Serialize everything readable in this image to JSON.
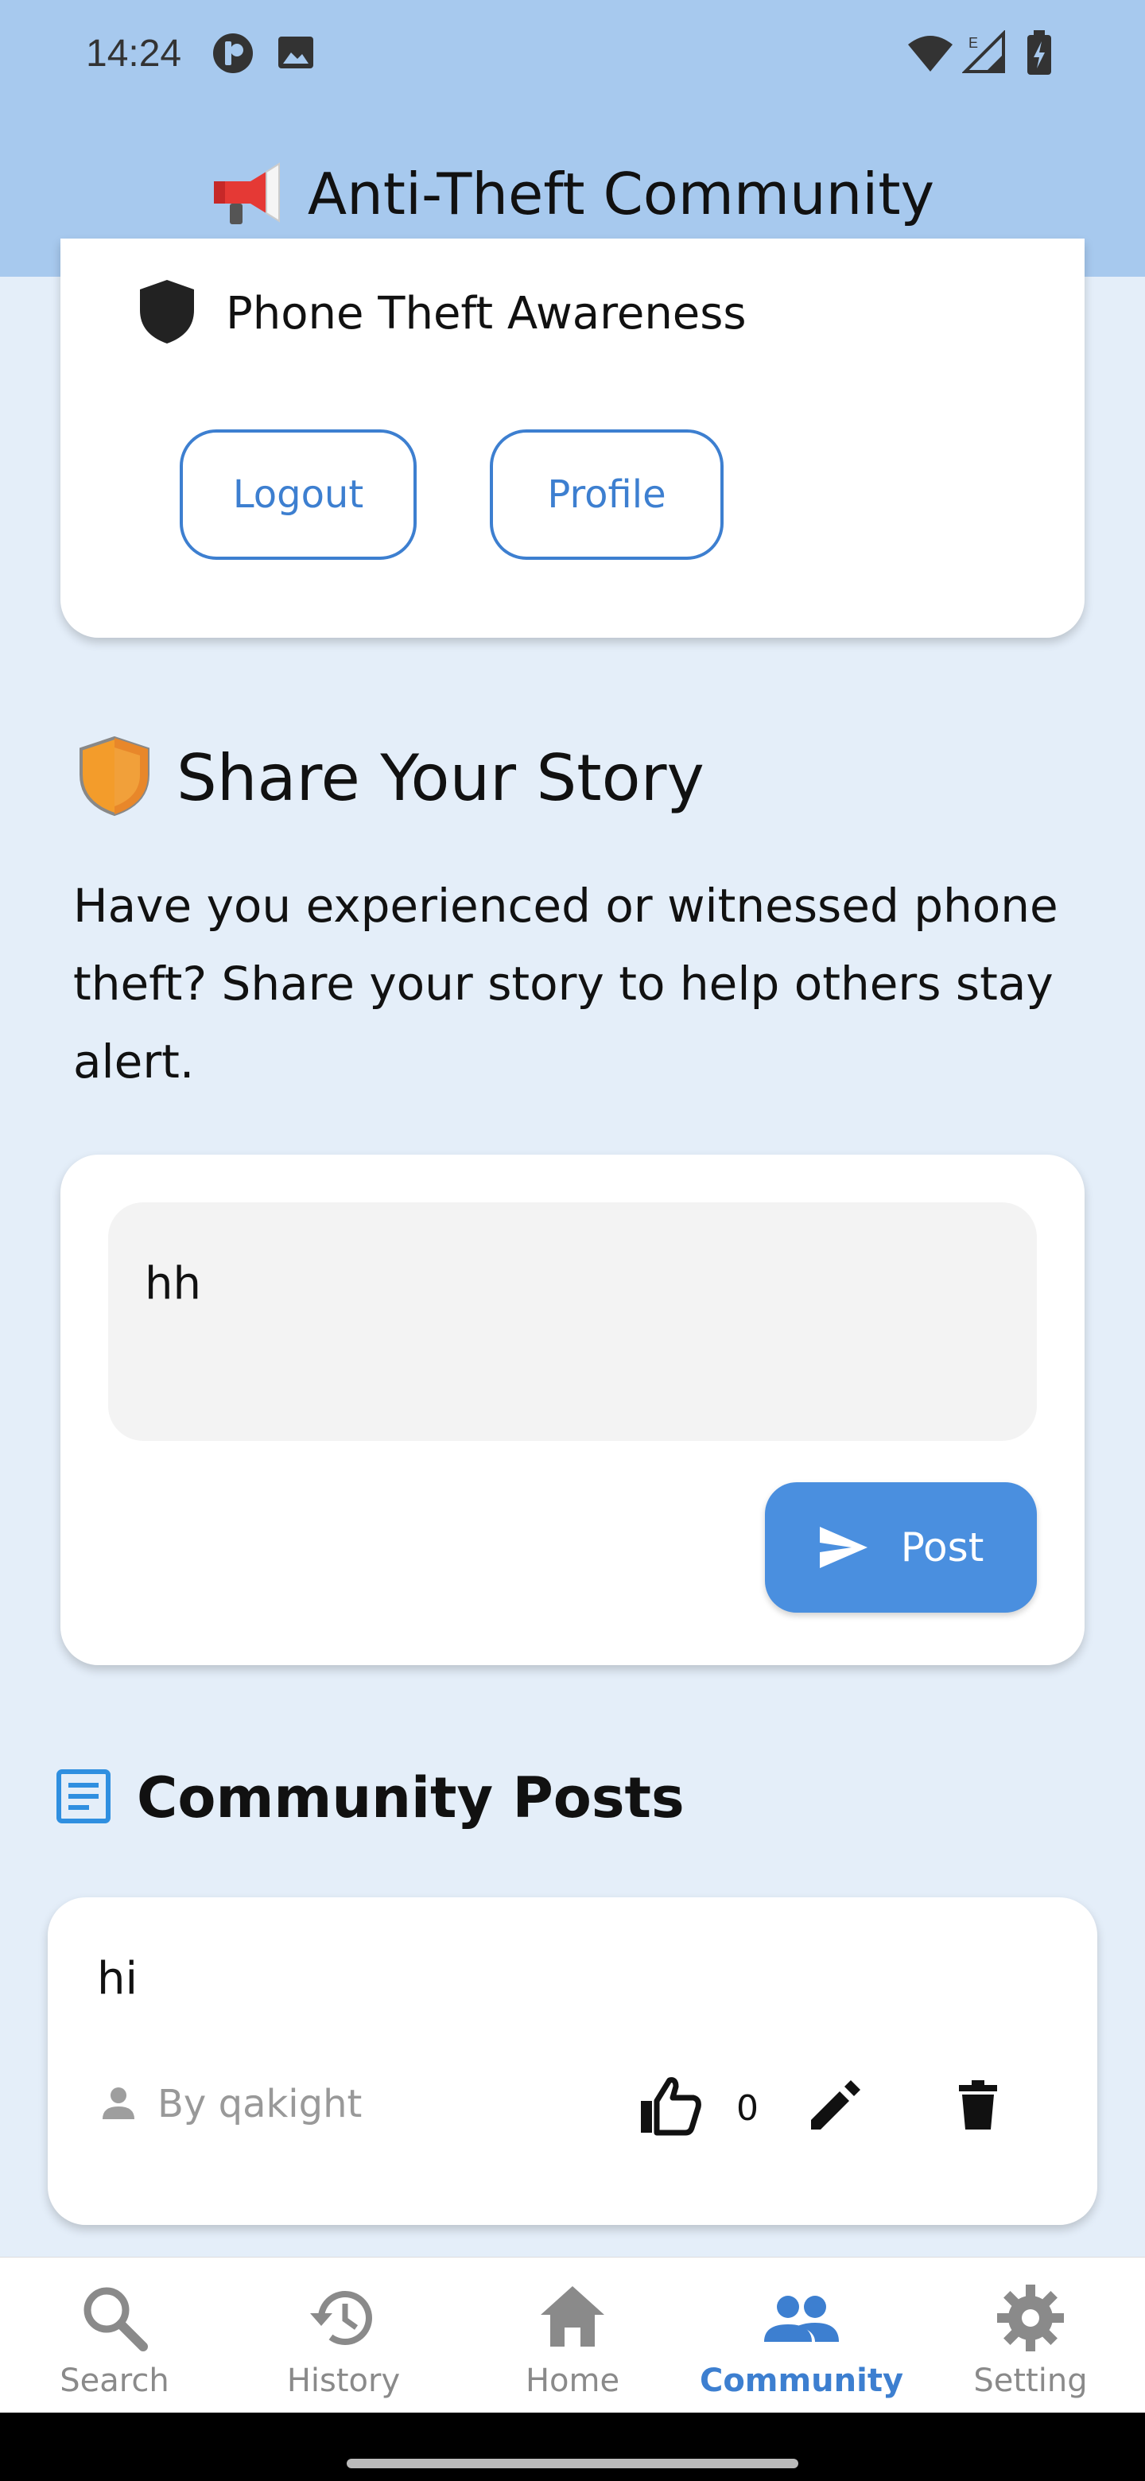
{
  "status": {
    "time": "14:24"
  },
  "app": {
    "title": "Anti-Theft Community",
    "title_emoji": "📢"
  },
  "account": {
    "awareness_label": "Phone Theft Awareness",
    "logout_label": "Logout",
    "profile_label": "Profile"
  },
  "story": {
    "emoji": "🛡️",
    "title": "Share Your Story",
    "description": "Have you experienced or witnessed phone theft? Share your story to help others stay alert.",
    "input_value": "hh",
    "post_label": "Post"
  },
  "posts": {
    "title": "Community Posts",
    "items": [
      {
        "text": "hi",
        "author": "By qakight",
        "likes": "0"
      }
    ]
  },
  "nav": {
    "items": [
      {
        "label": "Search",
        "icon": "search-icon"
      },
      {
        "label": "History",
        "icon": "history-icon"
      },
      {
        "label": "Home",
        "icon": "home-icon"
      },
      {
        "label": "Community",
        "icon": "community-icon"
      },
      {
        "label": "Setting",
        "icon": "settings-icon"
      }
    ],
    "active": "Community"
  },
  "colors": {
    "appbar": "#a7c9ee",
    "background": "#e4eef9",
    "accent": "#3d7fd0",
    "post_button": "#4a8fdf"
  }
}
